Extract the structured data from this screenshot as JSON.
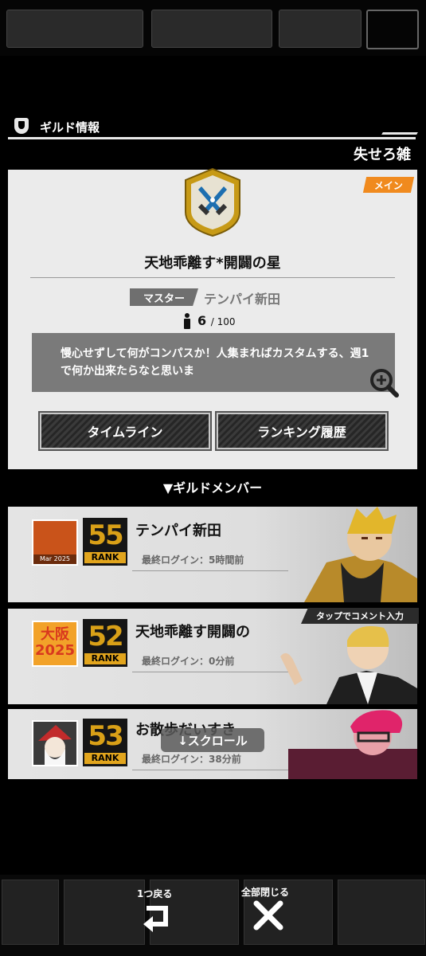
{
  "header": {
    "title": "ギルド情報",
    "subtitle": "失せろ雑"
  },
  "guild": {
    "badge": "メイン",
    "name": "天地乖離す*開闢の星",
    "master_label": "マスター",
    "master_name": "テンパイ新田",
    "member_count": "6",
    "member_max": "/ 100",
    "description": "慢心せずして何がコンパスか！人集まればカスタムする、週1で何か出来たらなと思いま"
  },
  "buttons": {
    "timeline": "タイムライン",
    "ranking_history": "ランキング履歴"
  },
  "members_header": "▼ギルドメンバー",
  "members": [
    {
      "name": "テンパイ新田",
      "rank": "55",
      "rank_label": "RANK",
      "last_login": "最終ログイン：5時間前",
      "avatar_text": "Mar 2025"
    },
    {
      "name": "天地乖離す開闢の",
      "rank": "52",
      "rank_label": "RANK",
      "last_login": "最終ログイン：0分前",
      "avatar_text": "大阪 2025"
    },
    {
      "name": "お散歩だいすき",
      "rank": "53",
      "rank_label": "RANK",
      "last_login": "最終ログイン：38分前",
      "avatar_text": ""
    }
  ],
  "tap_comment": "タップでコメント入力",
  "scroll_hint": "↓スクロール",
  "footer": {
    "back_label": "1つ戻る",
    "close_all_label": "全部閉じる"
  },
  "colors": {
    "accent_orange": "#f08a1e",
    "rank_gold": "#e2a51d",
    "card_bg": "#ebebeb"
  }
}
